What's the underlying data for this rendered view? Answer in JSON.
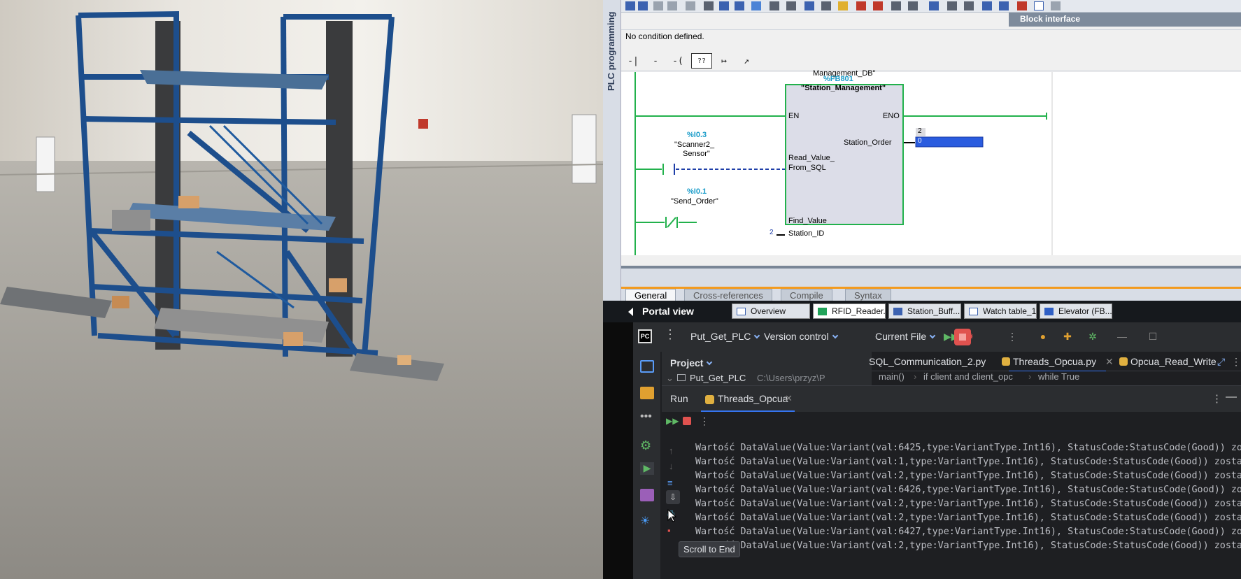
{
  "simulation": {
    "scene": "factory-floor-elevator"
  },
  "tia": {
    "sidebar_label": "PLC programming",
    "block_interface_label": "Block interface",
    "condition_text": "No condition defined.",
    "ladder_buttons": [
      "-| |-",
      "-|/|-",
      "-( )-",
      "??",
      "↦",
      "↗"
    ],
    "network": {
      "db_name_partial": "Management_DB\"",
      "fb_address": "%FB801",
      "fb_name": "\"Station_Management\"",
      "en": "EN",
      "eno": "ENO",
      "out_station_order": "Station_Order",
      "out_value_top": "2",
      "out_value_box": "0",
      "in_read_value_1": "Read_Value_",
      "in_read_value_2": "From_SQL",
      "in_find_value": "Find_Value",
      "in_station_id": "Station_ID",
      "station_id_value": "2",
      "contact1_addr": "%I0.3",
      "contact1_name1": "\"Scanner2_",
      "contact1_name2": "Sensor\"",
      "contact2_addr": "%I0.1",
      "contact2_name": "\"Send_Order\""
    },
    "bottom_tabs": [
      "General",
      "Cross-references",
      "Compile",
      "Syntax"
    ],
    "portal_view": "Portal view",
    "taskbar": [
      "Overview",
      "RFID_Reader...",
      "Station_Buff...",
      "Watch table_1",
      "Elevator (FB..."
    ]
  },
  "pycharm": {
    "logo": "PC",
    "project_name": "Put_Get_PLC",
    "version_control": "Version control",
    "run_config": "Current File",
    "project_header": "Project",
    "tree_root": "Put_Get_PLC",
    "tree_root_path": "C:\\Users\\przyz\\P",
    "file_tabs": [
      "SQL_Communication_2.py",
      "Threads_Opcua.py",
      "Opcua_Read_Write."
    ],
    "breadcrumb": [
      "main()",
      "if client and client_opc",
      "while True"
    ],
    "run_label": "Run",
    "run_tab": "Threads_Opcua",
    "tooltip": "Scroll to End",
    "console_lines": [
      "Wartość DataValue(Value:Variant(val:6425,type:VariantType.Int16), StatusCode:StatusCode(Good)) zo",
      "Wartość DataValue(Value:Variant(val:1,type:VariantType.Int16), StatusCode:StatusCode(Good)) zosta",
      "Wartość DataValue(Value:Variant(val:2,type:VariantType.Int16), StatusCode:StatusCode(Good)) zosta",
      "Wartość DataValue(Value:Variant(val:6426,type:VariantType.Int16), StatusCode:StatusCode(Good)) zo",
      "Wartość DataValue(Value:Variant(val:2,type:VariantType.Int16), StatusCode:StatusCode(Good)) zosta",
      "Wartość DataValue(Value:Variant(val:2,type:VariantType.Int16), StatusCode:StatusCode(Good)) zosta",
      "Wartość DataValue(Value:Variant(val:6427,type:VariantType.Int16), StatusCode:StatusCode(Good)) zo",
      "Wartość DataValue(Value:Variant(val:2,type:VariantType.Int16), StatusCode:StatusCode(Good)) zosta"
    ]
  },
  "colors": {
    "ladder_green": "#22b14c",
    "fb_blue": "#1a9cc9",
    "value_box_blue": "#2a5cdf",
    "pycharm_accent": "#3574f0",
    "frame_blue": "#1d4e8c"
  }
}
